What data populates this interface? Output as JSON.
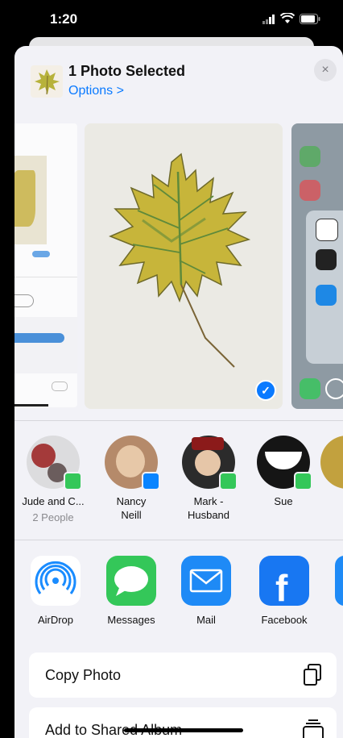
{
  "status_bar": {
    "time": "1:20"
  },
  "header": {
    "title": "1 Photo Selected",
    "options": "Options >",
    "close": "×"
  },
  "people": [
    {
      "name": "Jude and C...",
      "sub": "2 People",
      "badge": "messages"
    },
    {
      "name": "Nancy\nNeill",
      "sub": "",
      "badge": "messenger"
    },
    {
      "name": "Mark -\nHusband",
      "sub": "",
      "badge": "messages"
    },
    {
      "name": "Sue",
      "sub": "",
      "badge": "messages"
    }
  ],
  "apps": [
    {
      "name": "AirDrop",
      "icon": "airdrop-icon"
    },
    {
      "name": "Messages",
      "icon": "messages-icon"
    },
    {
      "name": "Mail",
      "icon": "mail-icon"
    },
    {
      "name": "Facebook",
      "icon": "facebook-icon"
    }
  ],
  "actions": [
    {
      "label": "Copy Photo",
      "icon": "copy-icon"
    },
    {
      "label": "Add to Shared Album",
      "icon": "shared-album-icon"
    }
  ],
  "colors": {
    "accent": "#0a7aff",
    "messages_green": "#34c759",
    "sheet_bg": "#f2f2f7"
  }
}
